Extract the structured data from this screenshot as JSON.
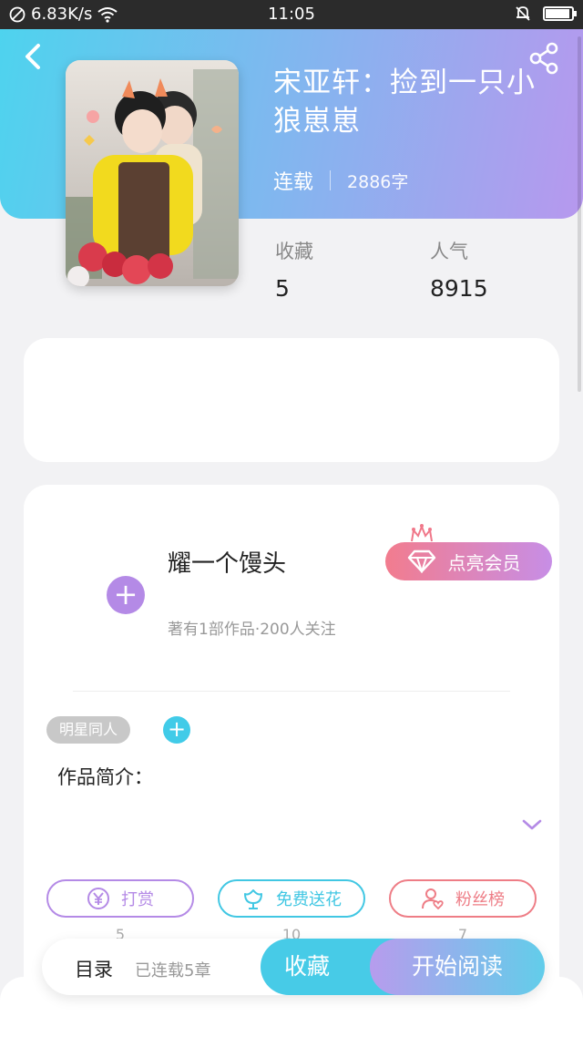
{
  "statusbar": {
    "speed": "6.83K/s",
    "time": "11:05"
  },
  "book": {
    "title": "宋亚轩：捡到一只小狼崽崽",
    "status": "连载",
    "word_count": "2886字",
    "stats": [
      {
        "label": "收藏",
        "value": "5"
      },
      {
        "label": "人气",
        "value": "8915"
      }
    ]
  },
  "author": {
    "name": "耀一个馒头",
    "info": "著有1部作品·200人关注",
    "vip_label": "点亮会员"
  },
  "tag": "明星同人",
  "intro_label": "作品简介：",
  "actions": [
    {
      "label": "打赏",
      "count": "5",
      "color": "#b48ae6"
    },
    {
      "label": "免费送花",
      "count": "10",
      "color": "#41c7e3"
    },
    {
      "label": "粉丝榜",
      "count": "7",
      "color": "#ee7d86"
    }
  ],
  "bottom": {
    "toc": "目录",
    "chapters": "已连载5章",
    "favorite": "收藏",
    "read": "开始阅读"
  }
}
